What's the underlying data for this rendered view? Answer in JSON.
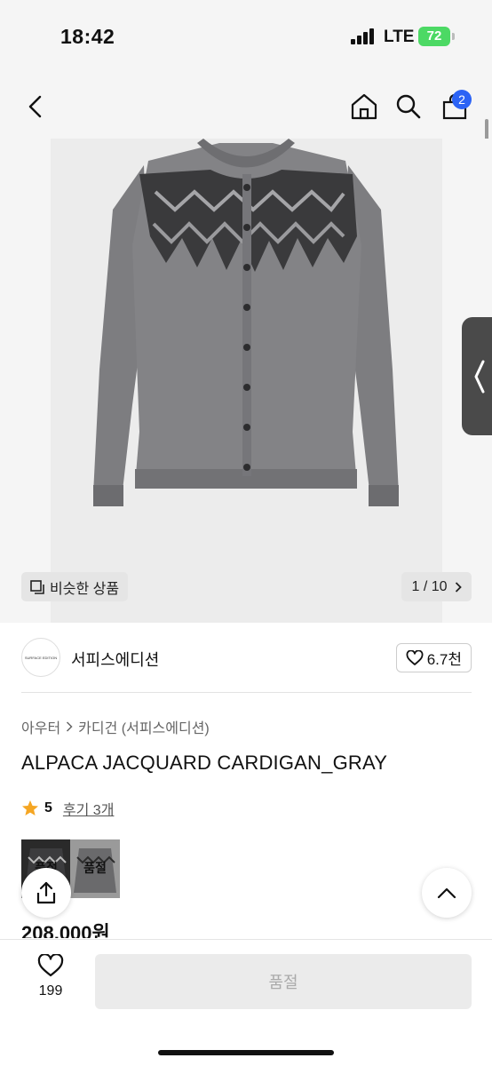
{
  "status_bar": {
    "time": "18:42",
    "network": "LTE",
    "battery": "72"
  },
  "nav": {
    "cart_count": "2"
  },
  "gallery": {
    "similar_label": "비슷한 상품",
    "page_counter": "1 / 10"
  },
  "brand": {
    "logo_text": "SURFACE EDITION",
    "name": "서피스에디션",
    "likes": "6.7천"
  },
  "breadcrumb": {
    "category": "아우터",
    "subcategory": "카디건 (서피스에디션)"
  },
  "product": {
    "title": "ALPACA JACQUARD CARDIGAN_GRAY",
    "rating": "5",
    "reviews": "후기 3개",
    "price": "208,000원",
    "variants": [
      {
        "label": "품절"
      },
      {
        "label": "품절"
      }
    ]
  },
  "bottom_bar": {
    "wish_count": "199",
    "soldout_label": "품절"
  },
  "colors": {
    "accent": "#2b63f5",
    "star": "#f5a623",
    "battery": "#4cd964"
  }
}
